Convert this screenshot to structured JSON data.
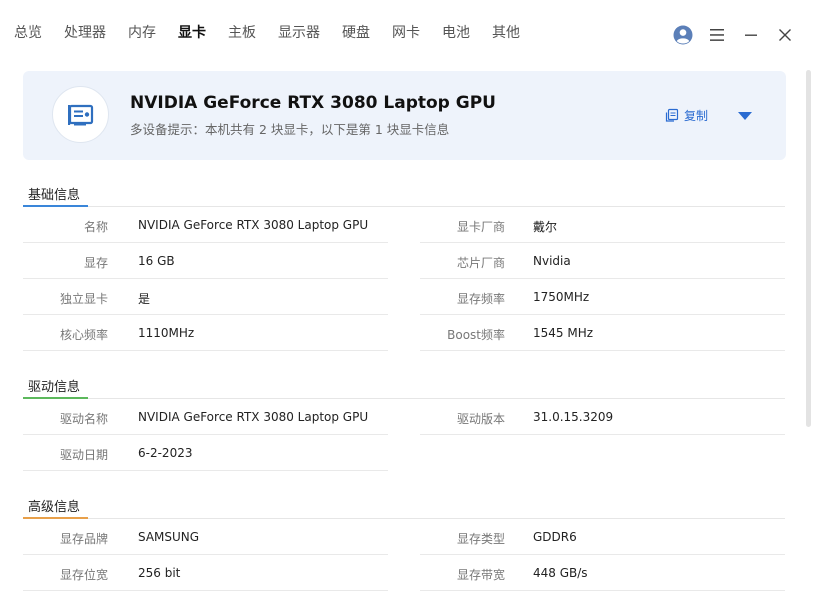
{
  "nav": {
    "tabs": [
      {
        "label": "总览"
      },
      {
        "label": "处理器"
      },
      {
        "label": "内存"
      },
      {
        "label": "显卡"
      },
      {
        "label": "主板"
      },
      {
        "label": "显示器"
      },
      {
        "label": "硬盘"
      },
      {
        "label": "网卡"
      },
      {
        "label": "电池"
      },
      {
        "label": "其他"
      }
    ],
    "active_tab": "显卡"
  },
  "header": {
    "gpu_name": "NVIDIA GeForce RTX 3080 Laptop GPU",
    "multi_device_hint": "多设备提示：本机共有 2 块显卡，以下是第 1 块显卡信息",
    "copy_label": "复制"
  },
  "sections": {
    "basic": {
      "title": "基础信息",
      "color": "#3a86d9",
      "rows": [
        {
          "lk": "名称",
          "lv": "NVIDIA GeForce RTX 3080 Laptop GPU",
          "rk": "显卡厂商",
          "rv": "戴尔"
        },
        {
          "lk": "显存",
          "lv": "16 GB",
          "rk": "芯片厂商",
          "rv": "Nvidia"
        },
        {
          "lk": "独立显卡",
          "lv": "是",
          "rk": "显存频率",
          "rv": "1750MHz"
        },
        {
          "lk": "核心频率",
          "lv": "1110MHz",
          "rk": "Boost频率",
          "rv": "1545 MHz"
        }
      ]
    },
    "driver": {
      "title": "驱动信息",
      "color": "#5cb85c",
      "rows": [
        {
          "lk": "驱动名称",
          "lv": "NVIDIA GeForce RTX 3080 Laptop GPU",
          "rk": "驱动版本",
          "rv": "31.0.15.3209"
        },
        {
          "lk": "驱动日期",
          "lv": "6-2-2023",
          "rk": "",
          "rv": ""
        }
      ]
    },
    "advanced": {
      "title": "高级信息",
      "color": "#e8a04a",
      "rows": [
        {
          "lk": "显存品牌",
          "lv": "SAMSUNG",
          "rk": "显存类型",
          "rv": "GDDR6"
        },
        {
          "lk": "显存位宽",
          "lv": "256 bit",
          "rk": "显存带宽",
          "rv": "448 GB/s"
        }
      ]
    }
  },
  "colors": {
    "accent": "#2a6bd1",
    "hero_bg": "#eef3fb"
  },
  "icons": {
    "avatar": "user-avatar-icon",
    "menu": "hamburger-menu-icon",
    "minimize": "minimize-icon",
    "close": "close-icon",
    "gpu": "graphics-card-icon",
    "copy": "copy-icon",
    "expand": "caret-down-icon"
  }
}
